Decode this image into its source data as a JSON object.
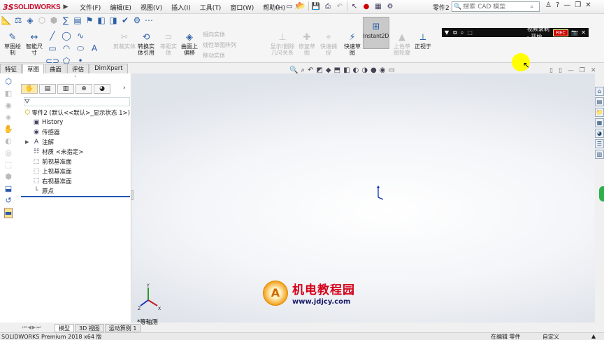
{
  "app": {
    "logo_prefix": "3S",
    "logo_text": "SOLIDWORKS",
    "doc_name": "零件2"
  },
  "menu": [
    "文件(F)",
    "编辑(E)",
    "视图(V)",
    "插入(I)",
    "工具(T)",
    "窗口(W)",
    "帮助(H)"
  ],
  "search": {
    "placeholder": "搜索 CAD 模型"
  },
  "commands": {
    "sketch": "草图绘制",
    "smart_dim": "智能尺寸",
    "trim": "剪裁实体",
    "convert": "转换实体引用",
    "offset": "等距实体",
    "surface_offset": "曲面上偏移",
    "mirror": "镜向实体",
    "linear_pattern": "线性草图阵列",
    "move": "移动实体",
    "display_delete": "显示/删除几何关系",
    "repair": "修复草图",
    "quick_snap": "快速捕捉",
    "rapid_sketch": "快速草图",
    "instant2d": "Instant2D",
    "shaded_contours": "上色草图轮廓",
    "normal_to": "正视于"
  },
  "recorder": {
    "title": "视频录制 - 开始",
    "badge": "REC"
  },
  "tabs": [
    "特征",
    "草图",
    "曲面",
    "评估",
    "DimXpert"
  ],
  "tree": {
    "root": "零件2  (默认<<默认>_显示状态 1>)",
    "items": [
      "History",
      "传感器",
      "注解",
      "材质 <未指定>",
      "前视基准面",
      "上视基准面",
      "右视基准面",
      "原点"
    ]
  },
  "view": {
    "name": "*等轴测"
  },
  "watermark": {
    "cn": "机电教程园",
    "url": "www.jdjcy.com",
    "logo_glyph": "A"
  },
  "model_tabs": [
    "模型",
    "3D 视图",
    "运动算例 1"
  ],
  "status": {
    "left": "SOLIDWORKS Premium 2018 x64 版",
    "mid": "在编辑 零件",
    "right": "自定义"
  }
}
